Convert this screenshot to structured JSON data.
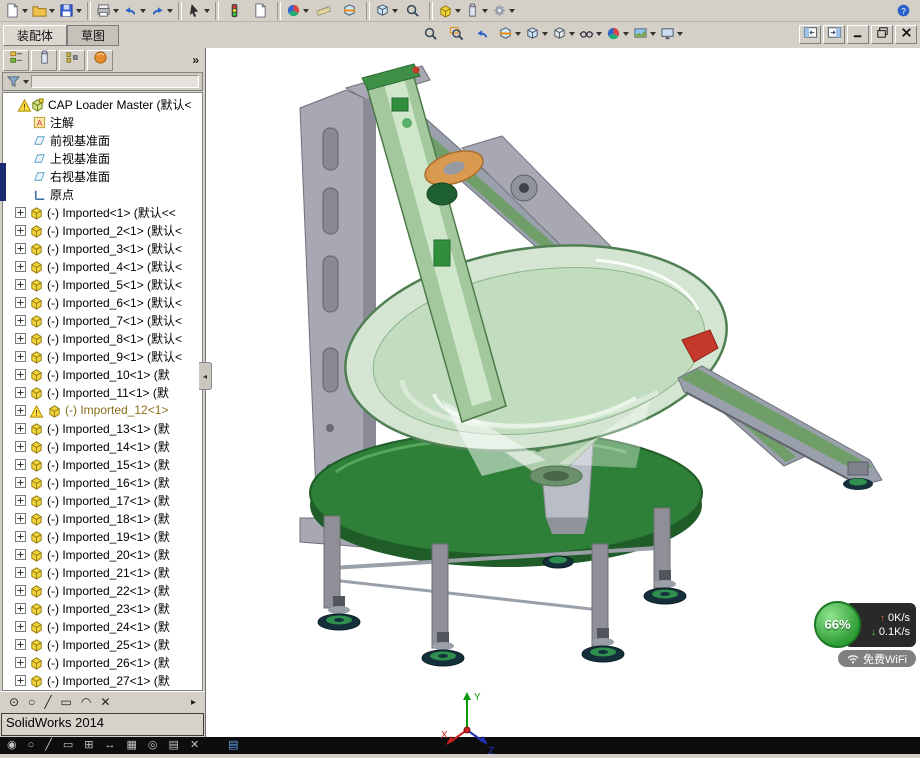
{
  "status": {
    "text": "SolidWorks 2014"
  },
  "doc_tabs": {
    "assembly": "装配体",
    "sketch": "草图"
  },
  "panel": {
    "overflow": "»"
  },
  "toolbar_main": {
    "items": [
      {
        "name": "new",
        "icon": "doc",
        "caret": true
      },
      {
        "name": "open",
        "icon": "folder",
        "caret": true
      },
      {
        "name": "save",
        "icon": "disk",
        "caret": true
      },
      {
        "sep": true
      },
      {
        "name": "print",
        "icon": "printer",
        "caret": true
      },
      {
        "name": "undo",
        "icon": "undo",
        "caret": true
      },
      {
        "name": "redo",
        "icon": "redo",
        "caret": true
      },
      {
        "sep": true
      },
      {
        "name": "select",
        "icon": "cursor",
        "caret": true
      },
      {
        "sep": true
      },
      {
        "name": "rebuild",
        "icon": "rebuild"
      },
      {
        "name": "file-properties",
        "icon": "doc"
      },
      {
        "sep": true
      },
      {
        "name": "edit-appearance",
        "icon": "ball",
        "caret": true
      },
      {
        "name": "measure",
        "icon": "ruler"
      },
      {
        "name": "section-view",
        "icon": "cube-section"
      },
      {
        "sep": true
      },
      {
        "name": "view-orientation",
        "icon": "cube",
        "caret": true
      },
      {
        "name": "zoom-to-fit",
        "icon": "magnifier"
      },
      {
        "sep": true
      },
      {
        "name": "insert-component",
        "icon": "part",
        "caret": true
      },
      {
        "name": "mate",
        "icon": "clip-tab",
        "caret": true
      },
      {
        "name": "options",
        "icon": "gear",
        "caret": true
      },
      {
        "name": "help",
        "icon": "help",
        "right": true
      }
    ]
  },
  "toolbar_view": {
    "items": [
      {
        "name": "zoom-fit",
        "icon": "magnifier"
      },
      {
        "name": "zoom-area",
        "icon": "magnifier-area"
      },
      {
        "name": "previous-view",
        "icon": "undo"
      },
      {
        "name": "section-view",
        "icon": "cube-section",
        "caret": true
      },
      {
        "name": "view-orientation",
        "icon": "cube",
        "caret": true
      },
      {
        "name": "display-style",
        "icon": "display-style",
        "caret": true
      },
      {
        "name": "hide-show-items",
        "icon": "glasses",
        "caret": true
      },
      {
        "name": "edit-appearance",
        "icon": "ball",
        "caret": true
      },
      {
        "name": "apply-scene",
        "icon": "scene",
        "caret": true
      },
      {
        "name": "view-settings",
        "icon": "monitor",
        "caret": true
      }
    ]
  },
  "window_controls": {
    "items": [
      {
        "name": "collapse-left-pane",
        "icon": "pane-left"
      },
      {
        "name": "expand-right-pane",
        "icon": "pane-right"
      },
      {
        "name": "minimize-window",
        "icon": "minimize"
      },
      {
        "name": "restore-window",
        "icon": "restore"
      },
      {
        "name": "close-window",
        "icon": "close"
      }
    ]
  },
  "panel_tabs": {
    "items": [
      {
        "name": "featuremanager-tab",
        "icon": "tree-tab"
      },
      {
        "name": "propertymanager-tab",
        "icon": "clip-tab"
      },
      {
        "name": "configurationmanager-tab",
        "icon": "config-tab"
      },
      {
        "name": "displaymanager-tab",
        "icon": "orange-ball"
      }
    ]
  },
  "panel_bottom": {
    "items": [
      {
        "name": "point-tool",
        "glyph": "⊙"
      },
      {
        "name": "circle-tool",
        "glyph": "○"
      },
      {
        "name": "line-tool",
        "glyph": "╱"
      },
      {
        "name": "rectangle-tool",
        "glyph": "▭"
      },
      {
        "name": "arc-tool",
        "glyph": "◠"
      },
      {
        "name": "erase-tool",
        "glyph": "✕"
      }
    ],
    "more_arrow": "▸"
  },
  "bottom_strip": {
    "items": [
      {
        "name": "pointer-tool",
        "glyph": "◉"
      },
      {
        "name": "circle-tool",
        "glyph": "○"
      },
      {
        "name": "line-tool",
        "glyph": "╱"
      },
      {
        "name": "rectangle-tool",
        "glyph": "▭"
      },
      {
        "name": "grid-tool",
        "glyph": "⊞"
      },
      {
        "name": "stretch-tool",
        "glyph": "↔"
      },
      {
        "name": "fill-tool",
        "glyph": "▦"
      },
      {
        "name": "target-tool",
        "glyph": "◎"
      },
      {
        "name": "layers-tool",
        "glyph": "▤"
      },
      {
        "name": "close-tool",
        "glyph": "✕"
      },
      {
        "name": "document-tool",
        "glyph": "▤",
        "color": "#5aa0e8"
      }
    ]
  },
  "tree": {
    "root": {
      "label": "CAP Loader Master",
      "suffix": "(默认<"
    },
    "items": [
      {
        "icon": "annotation",
        "label": "注解"
      },
      {
        "icon": "plane",
        "label": "前视基准面"
      },
      {
        "icon": "plane",
        "label": "上视基准面"
      },
      {
        "icon": "plane",
        "label": "右视基准面"
      },
      {
        "icon": "origin",
        "label": "原点"
      },
      {
        "icon": "part",
        "expand": true,
        "label": "(-) Imported<1>",
        "suffix": "(默认<<"
      },
      {
        "icon": "part",
        "expand": true,
        "label": "(-) Imported_2<1>",
        "suffix": "(默认<"
      },
      {
        "icon": "part",
        "expand": true,
        "label": "(-) Imported_3<1>",
        "suffix": "(默认<"
      },
      {
        "icon": "part",
        "expand": true,
        "label": "(-) Imported_4<1>",
        "suffix": "(默认<"
      },
      {
        "icon": "part",
        "expand": true,
        "label": "(-) Imported_5<1>",
        "suffix": "(默认<"
      },
      {
        "icon": "part",
        "expand": true,
        "label": "(-) Imported_6<1>",
        "suffix": "(默认<"
      },
      {
        "icon": "part",
        "expand": true,
        "label": "(-) Imported_7<1>",
        "suffix": "(默认<"
      },
      {
        "icon": "part",
        "expand": true,
        "label": "(-) Imported_8<1>",
        "suffix": "(默认<"
      },
      {
        "icon": "part",
        "expand": true,
        "label": "(-) Imported_9<1>",
        "suffix": "(默认<"
      },
      {
        "icon": "part",
        "expand": true,
        "label": "(-) Imported_10<1>",
        "suffix": "(默"
      },
      {
        "icon": "part",
        "expand": true,
        "label": "(-) Imported_11<1>",
        "suffix": "(默"
      },
      {
        "icon": "part",
        "expand": true,
        "warning": true,
        "color": "#8a6d1a",
        "label": "(-) Imported_12<1>",
        "suffix": ""
      },
      {
        "icon": "part",
        "expand": true,
        "label": "(-) Imported_13<1>",
        "suffix": "(默"
      },
      {
        "icon": "part",
        "expand": true,
        "label": "(-) Imported_14<1>",
        "suffix": "(默"
      },
      {
        "icon": "part",
        "expand": true,
        "label": "(-) Imported_15<1>",
        "suffix": "(默"
      },
      {
        "icon": "part",
        "expand": true,
        "label": "(-) Imported_16<1>",
        "suffix": "(默"
      },
      {
        "icon": "part",
        "expand": true,
        "label": "(-) Imported_17<1>",
        "suffix": "(默"
      },
      {
        "icon": "part",
        "expand": true,
        "label": "(-) Imported_18<1>",
        "suffix": "(默"
      },
      {
        "icon": "part",
        "expand": true,
        "label": "(-) Imported_19<1>",
        "suffix": "(默"
      },
      {
        "icon": "part",
        "expand": true,
        "label": "(-) Imported_20<1>",
        "suffix": "(默"
      },
      {
        "icon": "part",
        "expand": true,
        "label": "(-) Imported_21<1>",
        "suffix": "(默"
      },
      {
        "icon": "part",
        "expand": true,
        "label": "(-) Imported_22<1>",
        "suffix": "(默"
      },
      {
        "icon": "part",
        "expand": true,
        "label": "(-) Imported_23<1>",
        "suffix": "(默"
      },
      {
        "icon": "part",
        "expand": true,
        "label": "(-) Imported_24<1>",
        "suffix": "(默"
      },
      {
        "icon": "part",
        "expand": true,
        "label": "(-) Imported_25<1>",
        "suffix": "(默"
      },
      {
        "icon": "part",
        "expand": true,
        "label": "(-) Imported_26<1>",
        "suffix": "(默"
      },
      {
        "icon": "part",
        "expand": true,
        "label": "(-) Imported_27<1>",
        "suffix": "(默"
      }
    ]
  },
  "net": {
    "percent": "66%",
    "up": "0K/s",
    "down": "0.1K/s",
    "wifi": "免费WiFi"
  },
  "triad": {
    "x": "X",
    "y": "Y",
    "z": "Z"
  },
  "viewport": {
    "palette": {
      "frame": "#a8a8b4",
      "frameDark": "#8b8b98",
      "rail": "#a3c89e",
      "railLight": "#cfe6cb",
      "railDark": "#4e7a4a",
      "beam": "#9aa0ab",
      "beamStrip": "#6f9e68",
      "bowl": "#d4e6d2",
      "bowlInner": "#c2dcc0",
      "bowlCone": "#aecdac",
      "disc": "#2e8038",
      "discDark": "#1f5c27",
      "leg": "#8f9097",
      "foot": "#15303a",
      "footRing": "#2e8f4e",
      "red": "#c4392b",
      "orange": "#d99a4f"
    }
  }
}
